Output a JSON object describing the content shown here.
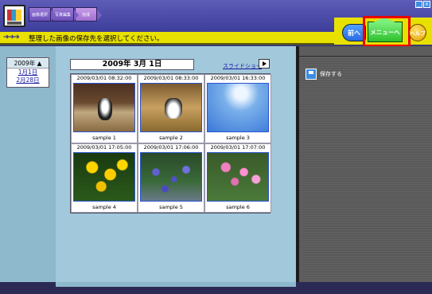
{
  "header": {
    "steps": [
      "画像選択",
      "写真編集",
      "完成"
    ],
    "win_controls": [
      "_",
      "x"
    ]
  },
  "band": {
    "arrows": "➔➔➔",
    "instruction": "整理した画像の保存先を選択してください。"
  },
  "nav": {
    "prev_label": "前へ",
    "menu_label": "メニューへ",
    "help_label": "ヘルプ"
  },
  "calendar": {
    "year": "2009年 ▲",
    "months": [
      "1月1日",
      "2月28日"
    ]
  },
  "main": {
    "date_title": "2009年 3月 1日",
    "slideshow_label": "スライドショー",
    "photos": [
      {
        "time": "2009/03/01 08:32:00",
        "name": "sample 1"
      },
      {
        "time": "2009/03/01 08:33:00",
        "name": "sample 2"
      },
      {
        "time": "2009/03/01 16:33:00",
        "name": "sample 3"
      },
      {
        "time": "2009/03/01 17:05:00",
        "name": "sample 4"
      },
      {
        "time": "2009/03/01 17:06:00",
        "name": "sample 5"
      },
      {
        "time": "2009/03/01 17:07:00",
        "name": "sample 6"
      }
    ]
  },
  "panel": {
    "save_label": "保存する"
  },
  "colors": {
    "band_yellow": "#e8e000",
    "highlight_red": "#e00000",
    "menu_green": "#2ec02e"
  }
}
